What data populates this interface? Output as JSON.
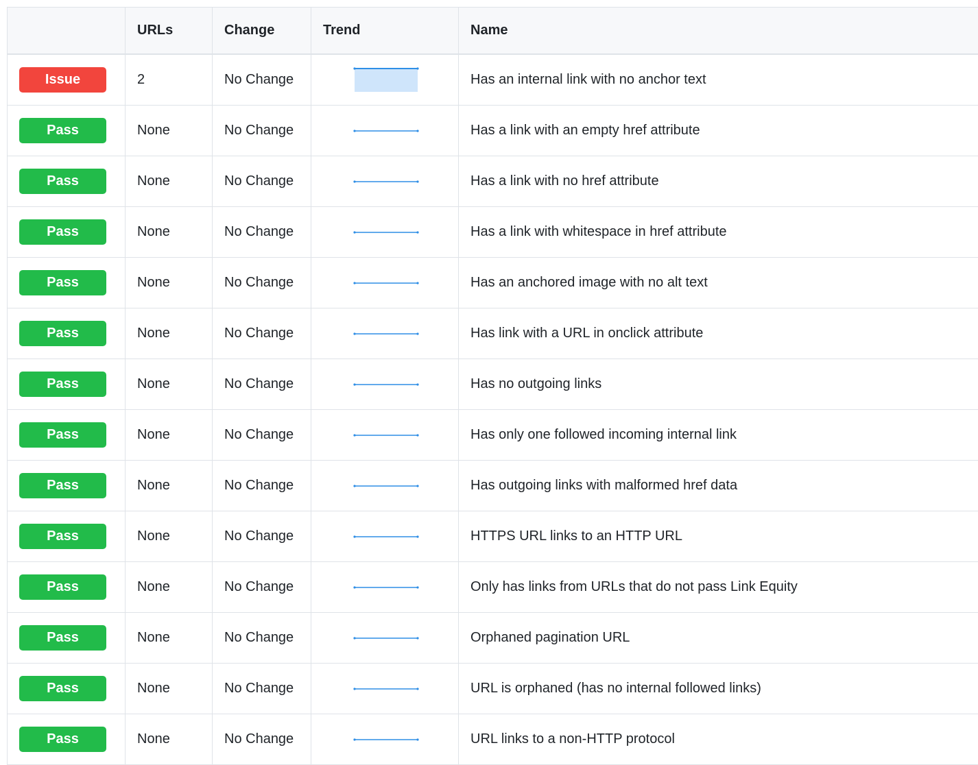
{
  "table": {
    "headers": {
      "status": "",
      "urls": "URLs",
      "change": "Change",
      "trend": "Trend",
      "name": "Name"
    },
    "rows": [
      {
        "status": "Issue",
        "status_kind": "issue",
        "urls": "2",
        "change": "No Change",
        "trend": "filled",
        "name": "Has an internal link with no anchor text"
      },
      {
        "status": "Pass",
        "status_kind": "pass",
        "urls": "None",
        "change": "No Change",
        "trend": "flat",
        "name": "Has a link with an empty href attribute"
      },
      {
        "status": "Pass",
        "status_kind": "pass",
        "urls": "None",
        "change": "No Change",
        "trend": "flat",
        "name": "Has a link with no href attribute"
      },
      {
        "status": "Pass",
        "status_kind": "pass",
        "urls": "None",
        "change": "No Change",
        "trend": "flat",
        "name": "Has a link with whitespace in href attribute"
      },
      {
        "status": "Pass",
        "status_kind": "pass",
        "urls": "None",
        "change": "No Change",
        "trend": "flat",
        "name": "Has an anchored image with no alt text"
      },
      {
        "status": "Pass",
        "status_kind": "pass",
        "urls": "None",
        "change": "No Change",
        "trend": "flat",
        "name": "Has link with a URL in onclick attribute"
      },
      {
        "status": "Pass",
        "status_kind": "pass",
        "urls": "None",
        "change": "No Change",
        "trend": "flat",
        "name": "Has no outgoing links"
      },
      {
        "status": "Pass",
        "status_kind": "pass",
        "urls": "None",
        "change": "No Change",
        "trend": "flat",
        "name": "Has only one followed incoming internal link"
      },
      {
        "status": "Pass",
        "status_kind": "pass",
        "urls": "None",
        "change": "No Change",
        "trend": "flat",
        "name": "Has outgoing links with malformed href data"
      },
      {
        "status": "Pass",
        "status_kind": "pass",
        "urls": "None",
        "change": "No Change",
        "trend": "flat",
        "name": "HTTPS URL links to an HTTP URL"
      },
      {
        "status": "Pass",
        "status_kind": "pass",
        "urls": "None",
        "change": "No Change",
        "trend": "flat",
        "name": "Only has links from URLs that do not pass Link Equity"
      },
      {
        "status": "Pass",
        "status_kind": "pass",
        "urls": "None",
        "change": "No Change",
        "trend": "flat",
        "name": "Orphaned pagination URL"
      },
      {
        "status": "Pass",
        "status_kind": "pass",
        "urls": "None",
        "change": "No Change",
        "trend": "flat",
        "name": "URL is orphaned (has no internal followed links)"
      },
      {
        "status": "Pass",
        "status_kind": "pass",
        "urls": "None",
        "change": "No Change",
        "trend": "flat",
        "name": "URL links to a non-HTTP protocol"
      }
    ]
  },
  "colors": {
    "issue": "#f2453d",
    "pass": "#22bb4a",
    "trend_line": "#2e8ee6",
    "trend_fill": "#cfe5fb"
  }
}
